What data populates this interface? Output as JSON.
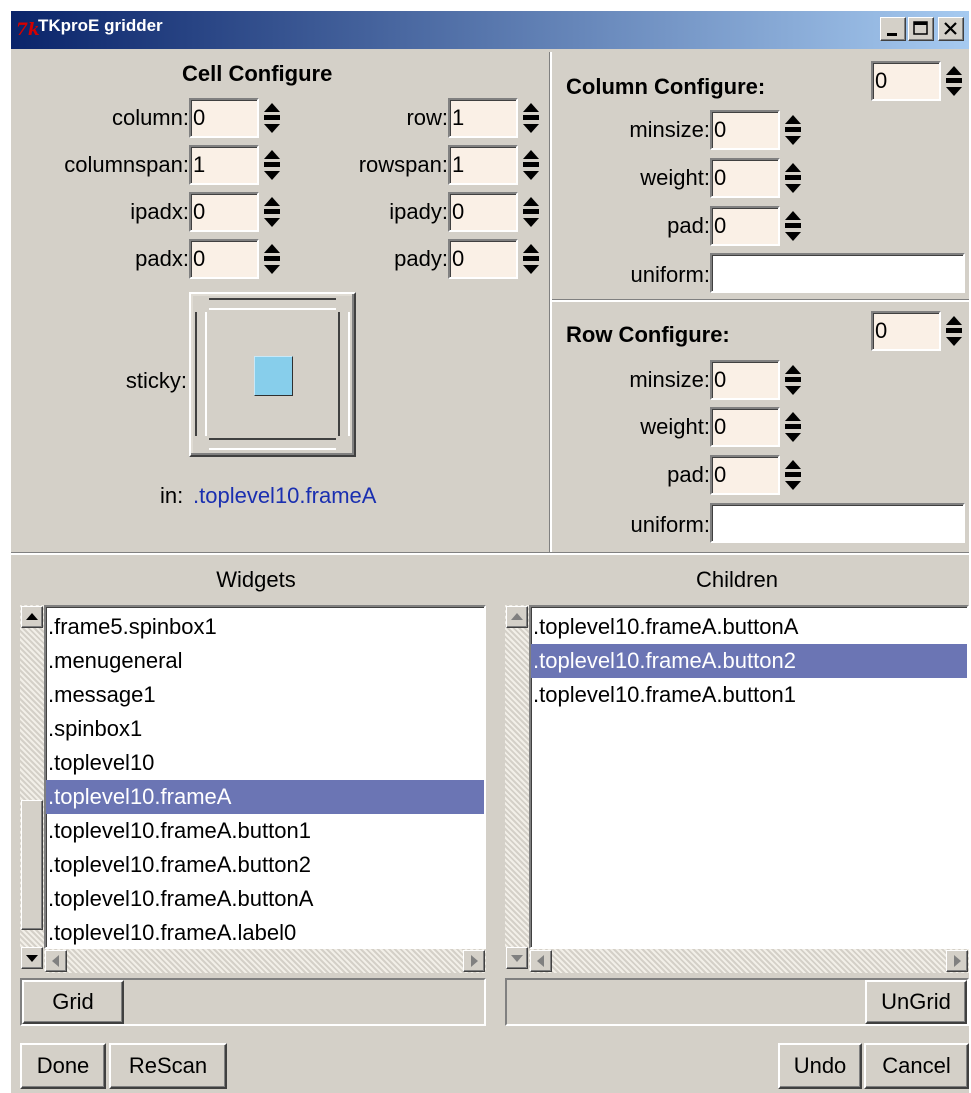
{
  "window": {
    "title": "TKproE gridder",
    "logo_text": "7k",
    "logo_color": "#d40000",
    "titlebar_color": "#0a246a"
  },
  "cell_configure": {
    "header": "Cell Configure",
    "column": {
      "label": "column:",
      "value": "0"
    },
    "row": {
      "label": "row:",
      "value": "1"
    },
    "columnspan": {
      "label": "columnspan:",
      "value": "1"
    },
    "rowspan": {
      "label": "rowspan:",
      "value": "1"
    },
    "ipadx": {
      "label": "ipadx:",
      "value": "0"
    },
    "ipady": {
      "label": "ipady:",
      "value": "0"
    },
    "padx": {
      "label": "padx:",
      "value": "0"
    },
    "pady": {
      "label": "pady:",
      "value": "0"
    },
    "sticky_label": "sticky:",
    "sticky_color": "#87ceeb",
    "in_label": "in:",
    "in_value": ".toplevel10.frameA"
  },
  "column_configure": {
    "header": "Column Configure:",
    "index": "0",
    "minsize": {
      "label": "minsize:",
      "value": "0"
    },
    "weight": {
      "label": "weight:",
      "value": "0"
    },
    "pad": {
      "label": "pad:",
      "value": "0"
    },
    "uniform": {
      "label": "uniform:",
      "value": ""
    }
  },
  "row_configure": {
    "header": "Row Configure:",
    "index": "0",
    "minsize": {
      "label": "minsize:",
      "value": "0"
    },
    "weight": {
      "label": "weight:",
      "value": "0"
    },
    "pad": {
      "label": "pad:",
      "value": "0"
    },
    "uniform": {
      "label": "uniform:",
      "value": ""
    }
  },
  "widgets": {
    "header": "Widgets",
    "items": [
      {
        "text": ".frame5.spinbox1",
        "selected": false
      },
      {
        "text": ".menugeneral",
        "selected": false
      },
      {
        "text": ".message1",
        "selected": false
      },
      {
        "text": ".spinbox1",
        "selected": false
      },
      {
        "text": ".toplevel10",
        "selected": false
      },
      {
        "text": ".toplevel10.frameA",
        "selected": true
      },
      {
        "text": ".toplevel10.frameA.button1",
        "selected": false
      },
      {
        "text": ".toplevel10.frameA.button2",
        "selected": false
      },
      {
        "text": ".toplevel10.frameA.buttonA",
        "selected": false
      },
      {
        "text": ".toplevel10.frameA.label0",
        "selected": false
      }
    ]
  },
  "children": {
    "header": "Children",
    "items": [
      {
        "text": ".toplevel10.frameA.buttonA",
        "selected": false
      },
      {
        "text": ".toplevel10.frameA.button2",
        "selected": true
      },
      {
        "text": ".toplevel10.frameA.button1",
        "selected": false
      }
    ]
  },
  "selection_color": "#6b75b4",
  "buttons": {
    "grid": "Grid",
    "ungrid": "UnGrid",
    "done": "Done",
    "rescan": "ReScan",
    "undo": "Undo",
    "cancel": "Cancel"
  }
}
